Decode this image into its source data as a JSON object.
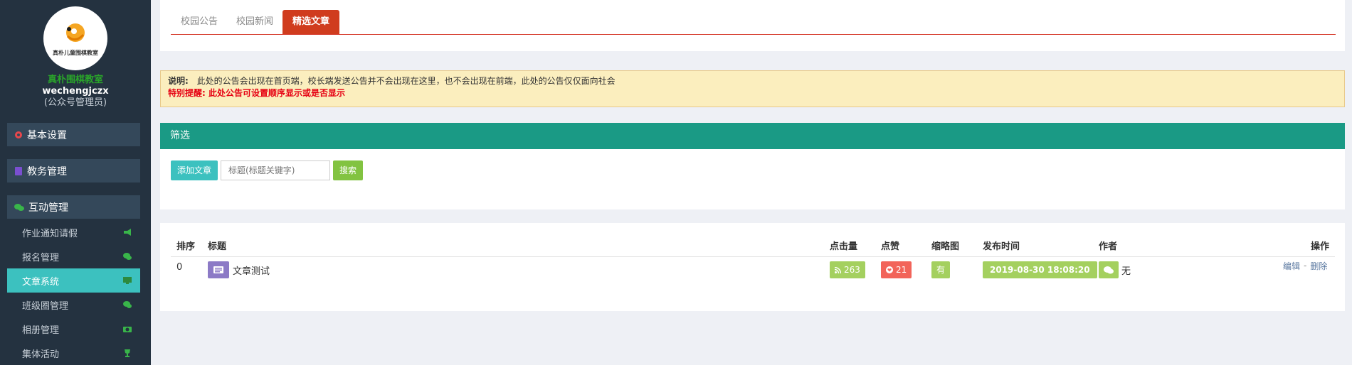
{
  "sidebar": {
    "logo_text": "真朴儿童围棋教室",
    "school_name": "真朴围棋教室",
    "account": "wechengjczx",
    "role": "(公众号管理员)",
    "groups": [
      {
        "label": "基本设置",
        "icon": "gear-icon",
        "color": "#e8474c"
      },
      {
        "label": "教务管理",
        "icon": "book-icon",
        "color": "#7a4fd0"
      },
      {
        "label": "互动管理",
        "icon": "wechat-icon",
        "color": "#39b54a"
      }
    ],
    "items": [
      {
        "label": "作业通知请假",
        "icon": "bullhorn-icon",
        "active": false
      },
      {
        "label": "报名管理",
        "icon": "chat-icon",
        "active": false
      },
      {
        "label": "文章系统",
        "icon": "monitor-icon",
        "active": true
      },
      {
        "label": "班级圈管理",
        "icon": "wechat-icon",
        "active": false
      },
      {
        "label": "相册管理",
        "icon": "camera-icon",
        "active": false
      },
      {
        "label": "集体活动",
        "icon": "trophy-icon",
        "active": false
      }
    ]
  },
  "tabs": [
    {
      "label": "校园公告",
      "active": false
    },
    {
      "label": "校园新闻",
      "active": false
    },
    {
      "label": "精选文章",
      "active": true
    }
  ],
  "notice": {
    "label": "说明:",
    "text": "此处的公告会出现在首页端，校长端发送公告并不会出现在这里，也不会出现在前端，此处的公告仅仅面向社会",
    "warning": "特别提醒: 此处公告可设置顺序显示或是否显示"
  },
  "filter": {
    "title": "筛选",
    "add_label": "添加文章",
    "search_placeholder": "标题(标题关键字)",
    "search_label": "搜索"
  },
  "table": {
    "headers": [
      "排序",
      "标题",
      "点击量",
      "点赞",
      "缩略图",
      "发布时间",
      "作者",
      "操作"
    ],
    "rows": [
      {
        "order": "0",
        "title": "文章测试",
        "clicks": "263",
        "likes": "21",
        "thumbnail": "有",
        "published": "2019-08-30 18:08:20",
        "author": "无",
        "edit": "编辑",
        "separator": "-",
        "delete": "删除"
      }
    ]
  },
  "colors": {
    "sidebar_bg": "#243240",
    "active_teal": "#3cc1bf",
    "filter_header": "#1a9a85",
    "tab_active": "#d03c1e",
    "badge_green": "#a4d05f",
    "badge_red": "#f2645a",
    "title_icon": "#8c7ac6"
  }
}
